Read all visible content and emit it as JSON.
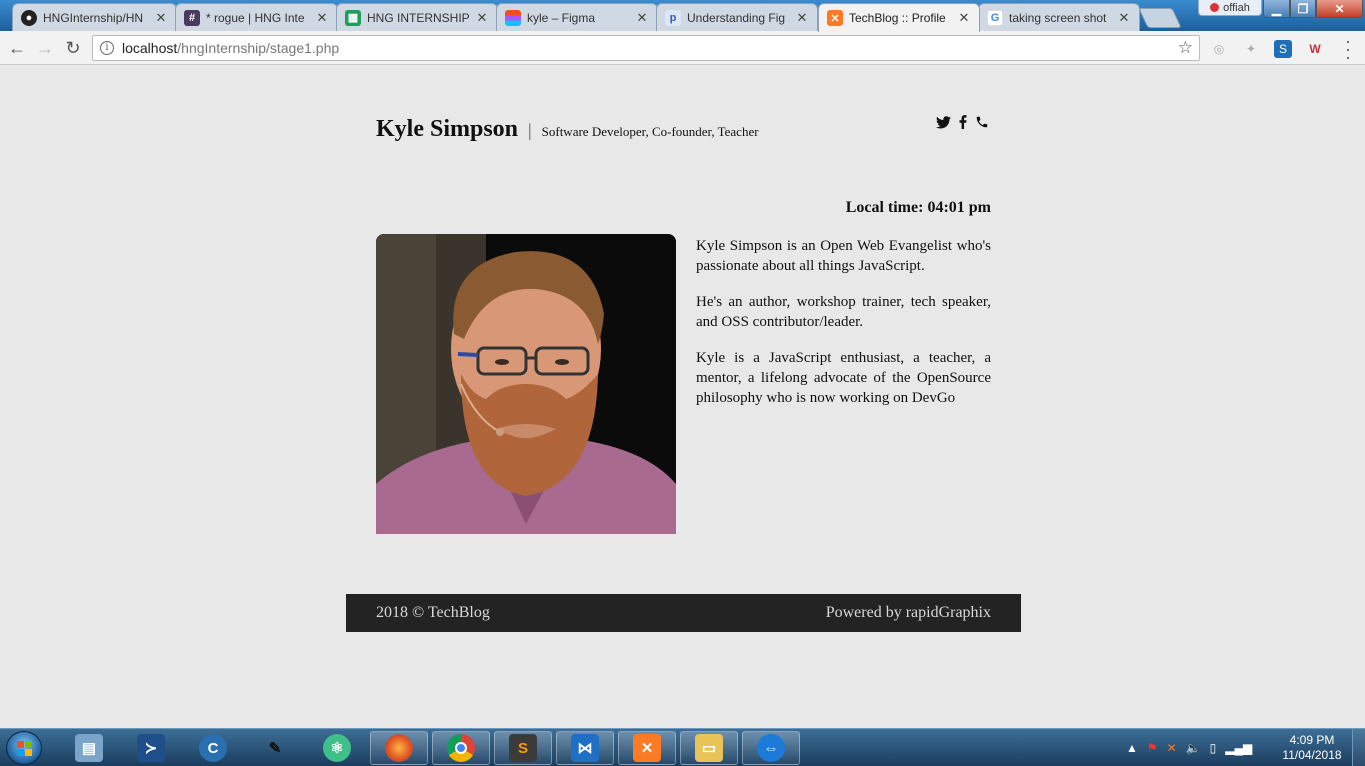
{
  "browser": {
    "tabs": [
      {
        "label": "HNGInternship/HN",
        "favicon": "github-icon",
        "active": false
      },
      {
        "label": "* rogue | HNG Inte",
        "favicon": "slack-hash-icon",
        "active": false
      },
      {
        "label": "HNG INTERNSHIP -",
        "favicon": "sheets-icon",
        "active": false
      },
      {
        "label": "kyle – Figma",
        "favicon": "figma-icon",
        "active": false
      },
      {
        "label": "Understanding Fig",
        "favicon": "p-icon",
        "active": false
      },
      {
        "label": "TechBlog :: Profile",
        "favicon": "xampp-icon",
        "active": true
      },
      {
        "label": "taking screen shot",
        "favicon": "google-icon",
        "active": false
      }
    ],
    "profile_name": "offiah",
    "url_host": "localhost",
    "url_path": "/hngInternship/stage1.php",
    "colors": {
      "tabstrip": "#1d6fb0",
      "active_tab": "#f2f2f2"
    }
  },
  "page": {
    "name": "Kyle Simpson",
    "separator": "|",
    "tagline": "Software Developer, Co-founder, Teacher",
    "social_icons": [
      "twitter-icon",
      "facebook-icon",
      "phone-icon"
    ],
    "local_time": "Local time: 04:01 pm",
    "bio": [
      "Kyle Simpson is an Open Web Evangelist who's passionate about all things JavaScript.",
      "He's an author, workshop trainer, tech speaker, and OSS contributor/leader.",
      "Kyle is a JavaScript enthusiast, a teacher, a mentor, a lifelong advocate of the OpenSource philosophy who is now working on DevGo"
    ],
    "footer_left": "2018 © TechBlog",
    "footer_right": "Powered by rapidGraphix",
    "colors": {
      "background": "#e8e8e8",
      "footer": "#232323",
      "footer_text": "#d8d8d8"
    }
  },
  "taskbar": {
    "apps": [
      "library-icon",
      "powershell-icon",
      "ccleaner-icon",
      "tools-icon",
      "atom-icon",
      "firefox-icon",
      "chrome-icon",
      "sublime-icon",
      "vscode-icon",
      "xampp-icon",
      "explorer-icon",
      "teamviewer-icon"
    ],
    "time": "4:09 PM",
    "date": "11/04/2018"
  }
}
